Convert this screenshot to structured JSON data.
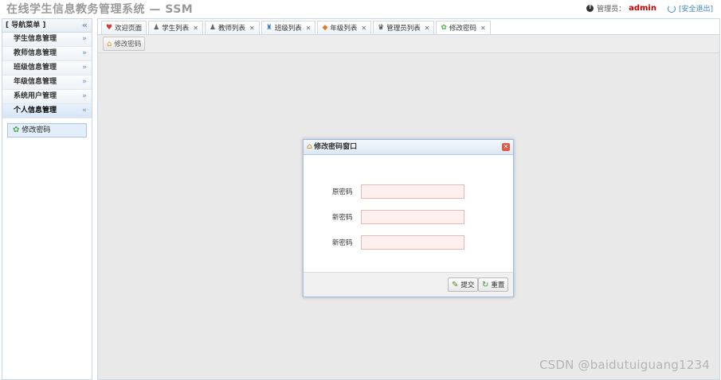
{
  "header": {
    "title": "在线学生信息教务管理系统 — SSM",
    "user_label": "管理员：",
    "username": "admin",
    "logout": "[安全退出]"
  },
  "sidebar": {
    "title": "[ 导航菜单 ]",
    "items": [
      {
        "label": "学生信息管理"
      },
      {
        "label": "教师信息管理"
      },
      {
        "label": "班级信息管理"
      },
      {
        "label": "年级信息管理"
      },
      {
        "label": "系统用户管理"
      },
      {
        "label": "个人信息管理"
      }
    ],
    "submenu_label": "修改密码"
  },
  "tabs": [
    {
      "label": "欢迎页面",
      "icon": "heart-icon",
      "closable": false
    },
    {
      "label": "学生列表",
      "icon": "student-icon",
      "closable": true
    },
    {
      "label": "教师列表",
      "icon": "teacher-icon",
      "closable": true
    },
    {
      "label": "班级列表",
      "icon": "class-icon",
      "closable": true
    },
    {
      "label": "年级列表",
      "icon": "grade-icon",
      "closable": true
    },
    {
      "label": "管理员列表",
      "icon": "admin-icon",
      "closable": true
    },
    {
      "label": "修改密码",
      "icon": "gear-icon",
      "closable": true
    }
  ],
  "toolbar": {
    "button": "修改密码"
  },
  "dialog": {
    "title": "修改密码窗口",
    "fields": [
      {
        "label": "原密码",
        "value": ""
      },
      {
        "label": "新密码",
        "value": ""
      },
      {
        "label": "新密码",
        "value": ""
      }
    ],
    "submit": "提交",
    "reset": "重置"
  },
  "watermark": "CSDN @baidutuiguang1234"
}
